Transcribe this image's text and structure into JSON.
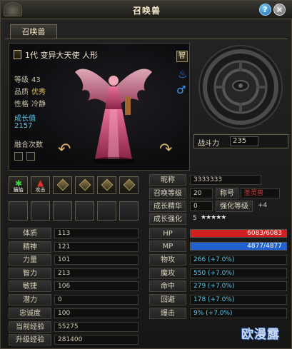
{
  "window": {
    "title": "召唤兽"
  },
  "tab": {
    "label": "召唤兽"
  },
  "pet": {
    "header": "1代 变异大天使 人形",
    "level_label": "等级",
    "level": "43",
    "quality_label": "品质",
    "quality": "优秀",
    "temper_label": "性格",
    "temper": "冷静",
    "growth_label": "成长值",
    "growth": "2157",
    "fuse_label": "融合次数",
    "tag": "智"
  },
  "combat": {
    "label": "战斗力",
    "value": "235"
  },
  "skills": [
    {
      "label": "猫抽",
      "kind": "green"
    },
    {
      "label": "攻击",
      "kind": "red"
    },
    {
      "label": "",
      "kind": "gold"
    },
    {
      "label": "",
      "kind": "gold"
    },
    {
      "label": "",
      "kind": "gold"
    },
    {
      "label": "",
      "kind": "gold"
    }
  ],
  "info": {
    "nickname_label": "昵称",
    "nickname": "3333333",
    "summon_level_label": "召唤等级",
    "summon_level": "20",
    "title_label": "称号",
    "title": "圣灵兽",
    "growth_refine_label": "成长精华",
    "growth_refine": "0",
    "enhance_level_label": "强化等级",
    "enhance_level": "+4",
    "growth_enhance_label": "成长强化",
    "growth_enhance": "5",
    "stars": "★★★★★"
  },
  "left_stats": [
    {
      "label": "体质",
      "value": "113"
    },
    {
      "label": "精神",
      "value": "121"
    },
    {
      "label": "力量",
      "value": "101"
    },
    {
      "label": "智力",
      "value": "213"
    },
    {
      "label": "敏捷",
      "value": "106"
    },
    {
      "label": "潜力",
      "value": "0"
    },
    {
      "label": "忠诚度",
      "value": "100"
    },
    {
      "label": "当前经验",
      "value": "55275"
    },
    {
      "label": "升级经验",
      "value": "281400"
    }
  ],
  "hp": {
    "label": "HP",
    "text": "6083/6083",
    "fraction": 1.0,
    "color": "#d02020"
  },
  "mp": {
    "label": "MP",
    "text": "4877/4877",
    "fraction": 1.0,
    "color": "#2060d0"
  },
  "right_stats": [
    {
      "label": "物攻",
      "value": "266 (+7.0%)"
    },
    {
      "label": "魔攻",
      "value": "550 (+7.0%)"
    },
    {
      "label": "命中",
      "value": "279 (+7.0%)"
    },
    {
      "label": "回避",
      "value": "178 (+7.0%)"
    },
    {
      "label": "爆击",
      "value": "9% (+7.0%)"
    }
  ],
  "watermark": "欧漫露"
}
